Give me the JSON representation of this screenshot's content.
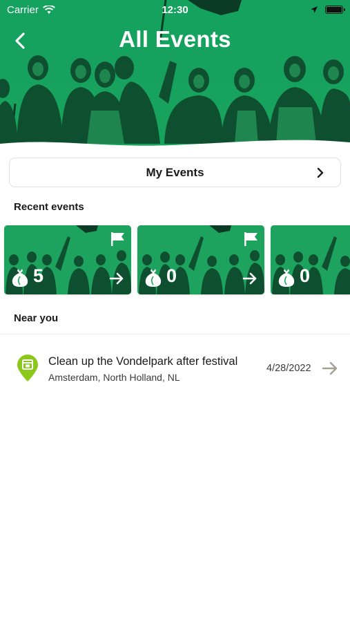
{
  "status_bar": {
    "carrier": "Carrier",
    "time": "12:30",
    "icons": [
      "wifi-icon",
      "location-arrow-icon",
      "battery-icon"
    ]
  },
  "header": {
    "title": "All Events",
    "back_icon": "chevron-left-icon"
  },
  "my_events": {
    "label": "My Events",
    "icon": "chevron-right-icon"
  },
  "recent_events": {
    "title": "Recent events",
    "cards": [
      {
        "count": "5",
        "flag_icon": "flag-icon",
        "bag_icon": "trash-bag-icon",
        "arrow_icon": "arrow-right-icon"
      },
      {
        "count": "0",
        "flag_icon": "flag-icon",
        "bag_icon": "trash-bag-icon",
        "arrow_icon": "arrow-right-icon"
      },
      {
        "count": "0",
        "flag_icon": "flag-icon",
        "bag_icon": "trash-bag-icon",
        "arrow_icon": "arrow-right-icon"
      }
    ]
  },
  "near_you": {
    "title": "Near you",
    "items": [
      {
        "title": "Clean up the Vondelpark after festival",
        "location": "Amsterdam, North Holland, NL",
        "date": "4/28/2022",
        "icon": "calendar-pin-icon",
        "arrow_icon": "arrow-right-icon"
      }
    ]
  },
  "colors": {
    "brand_green": "#1ea35e",
    "pin_green": "#8bc81b",
    "arrow_gray": "#a6a090",
    "text_dark": "#1b1b1b"
  }
}
